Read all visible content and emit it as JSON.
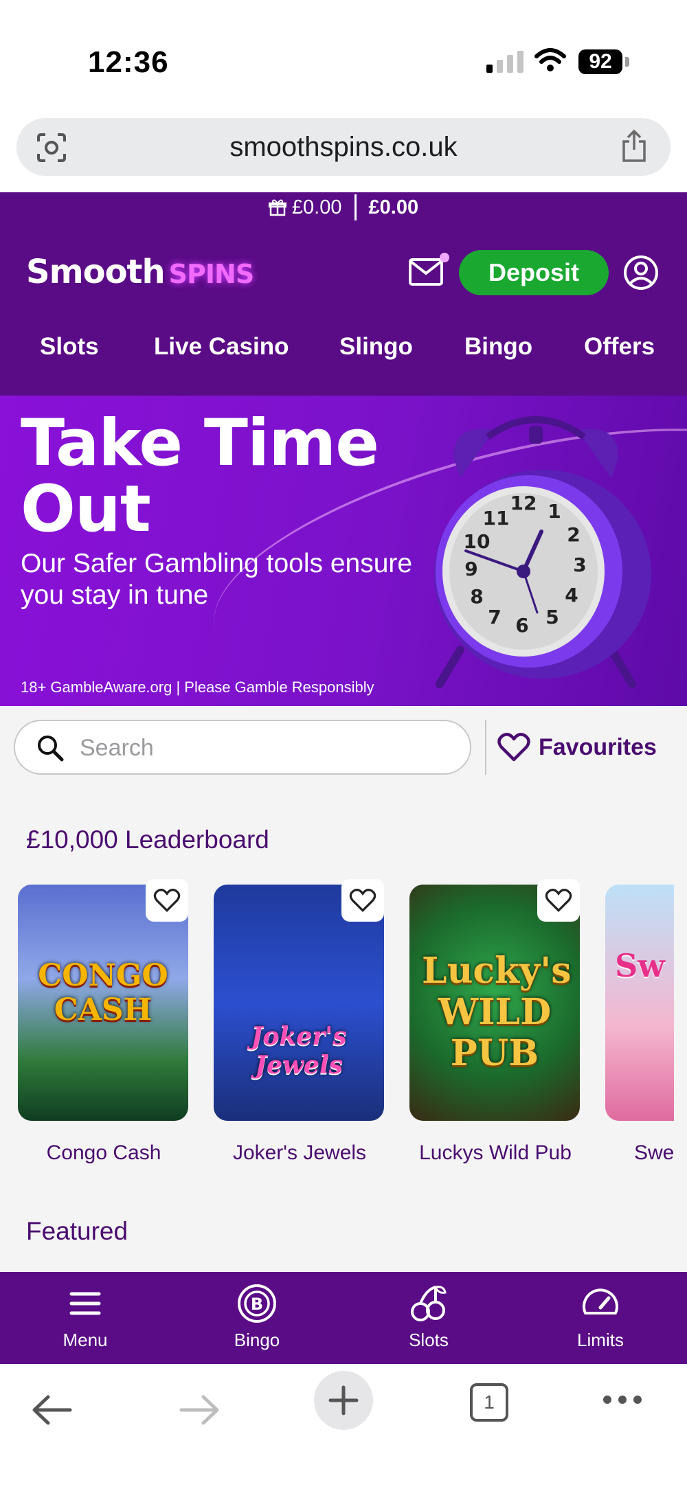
{
  "status_bar": {
    "time": "12:36",
    "battery": "92"
  },
  "browser": {
    "url": "smoothspins.co.uk",
    "tab_count": "1"
  },
  "header": {
    "bonus_balance": "£0.00",
    "cash_balance": "£0.00",
    "logo_part1": "Smooth",
    "logo_part2": "SPINS",
    "deposit_label": "Deposit",
    "nav": [
      "Slots",
      "Live Casino",
      "Slingo",
      "Bingo",
      "Offers"
    ]
  },
  "banner": {
    "title": "Take Time Out",
    "subtitle": "Our Safer Gambling tools ensure you stay in tune",
    "footer": "18+ GambleAware.org | Please Gamble Responsibly"
  },
  "search": {
    "placeholder": "Search"
  },
  "favourites_label": "Favourites",
  "sections": {
    "leaderboard_title": "£10,000 Leaderboard",
    "featured_title": "Featured"
  },
  "games": [
    {
      "name": "Congo Cash",
      "art_text": "CONGO CASH"
    },
    {
      "name": "Joker's Jewels",
      "art_text": "Joker's Jewels"
    },
    {
      "name": "Luckys Wild Pub",
      "art_text": "Lucky's WILD PUB"
    },
    {
      "name": "Swe Bo",
      "art_text": "Sw R Bo"
    }
  ],
  "bottom_nav": [
    "Menu",
    "Bingo",
    "Slots",
    "Limits"
  ],
  "colors": {
    "brand_purple": "#5a0b86",
    "deposit_green": "#1aa831",
    "accent_pink": "#f26bff"
  }
}
